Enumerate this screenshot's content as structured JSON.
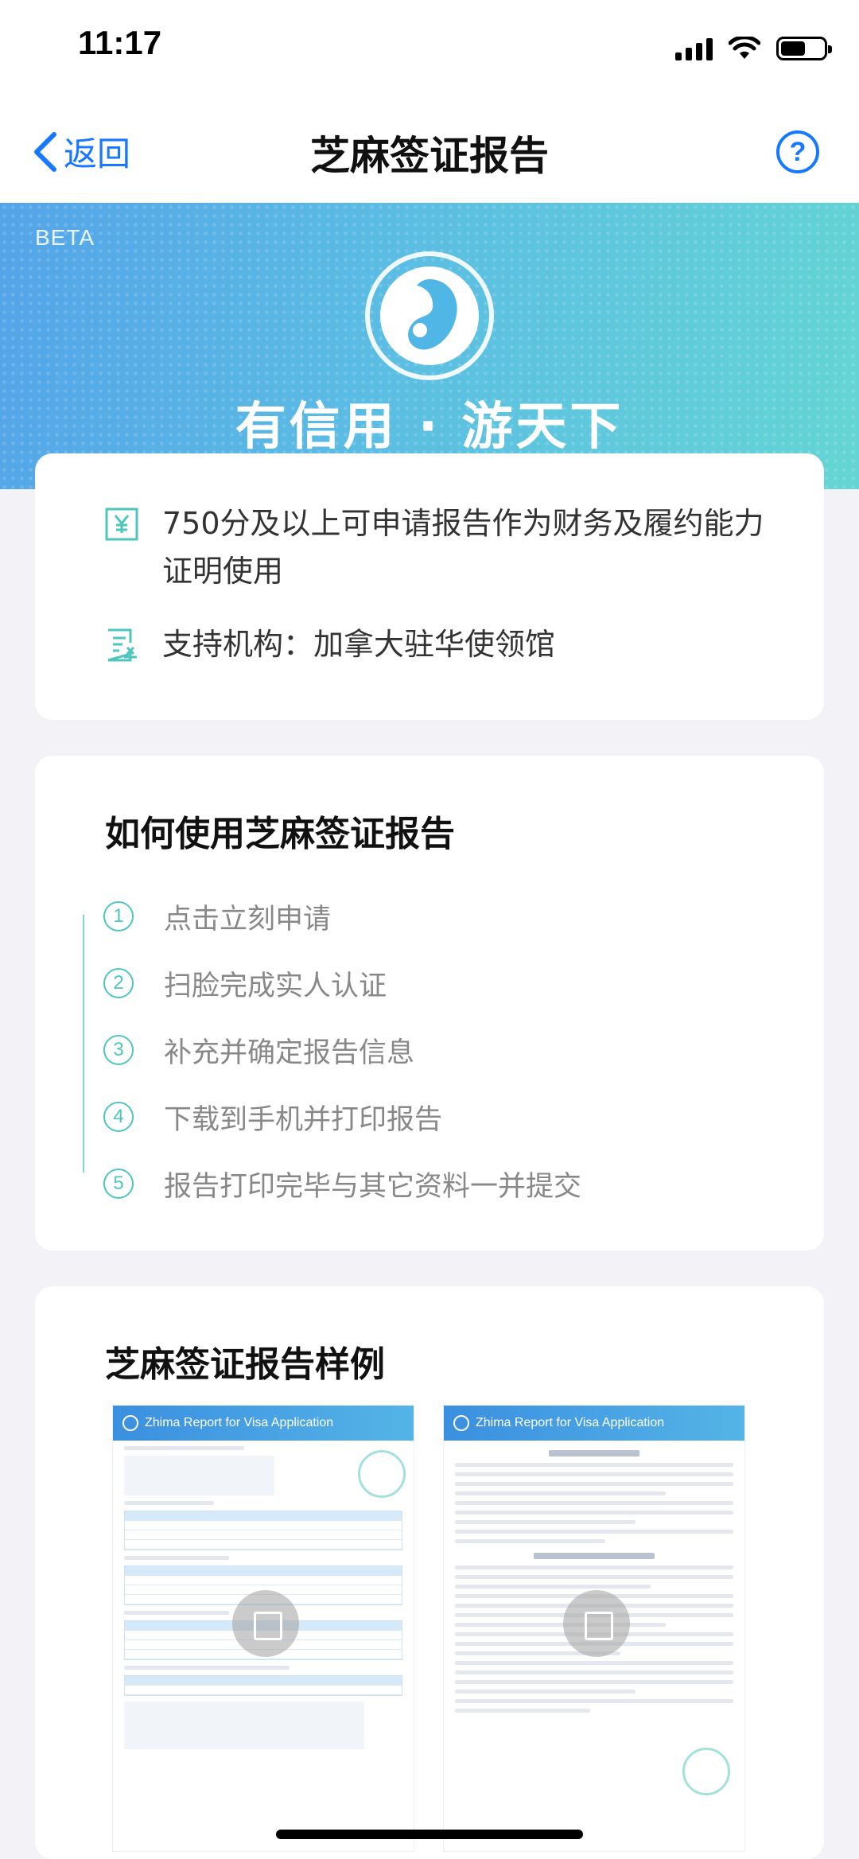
{
  "status_bar": {
    "time": "11:17"
  },
  "nav": {
    "back_label": "返回",
    "title": "芝麻签证报告",
    "help_symbol": "?"
  },
  "banner": {
    "badge": "BETA",
    "slogan": "有信用 · 游天下"
  },
  "info": {
    "requirement": "750分及以上可申请报告作为财务及履约能力证明使用",
    "institution": "支持机构：加拿大驻华使领馆"
  },
  "steps": {
    "heading": "如何使用芝麻签证报告",
    "items": [
      {
        "num": "1",
        "label": "点击立刻申请"
      },
      {
        "num": "2",
        "label": "扫脸完成实人认证"
      },
      {
        "num": "3",
        "label": "补充并确定报告信息"
      },
      {
        "num": "4",
        "label": "下载到手机并打印报告"
      },
      {
        "num": "5",
        "label": "报告打印完毕与其它资料一并提交"
      }
    ]
  },
  "samples": {
    "heading": "芝麻签证报告样例",
    "doc_header": "Zhima Report for Visa Application"
  },
  "colors": {
    "accent": "#1677ff",
    "teal": "#4fc6bd"
  },
  "icons": [
    "chevron-left-icon",
    "help-icon",
    "zhima-logo-icon",
    "money-doc-icon",
    "embassy-doc-icon",
    "zoom-icon"
  ]
}
